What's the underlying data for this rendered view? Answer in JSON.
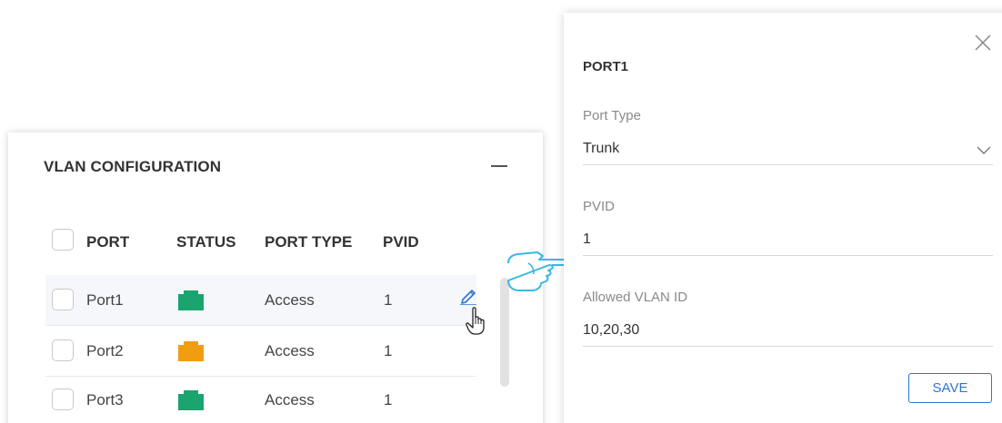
{
  "vlan_panel": {
    "title": "VLAN CONFIGURATION",
    "columns": {
      "port": "PORT",
      "status": "STATUS",
      "port_type": "PORT TYPE",
      "pvid": "PVID"
    },
    "rows": [
      {
        "port": "Port1",
        "status": "up",
        "status_color": "#1aa570",
        "port_type": "Access",
        "pvid": "1"
      },
      {
        "port": "Port2",
        "status": "warning",
        "status_color": "#f29d0f",
        "port_type": "Access",
        "pvid": "1"
      },
      {
        "port": "Port3",
        "status": "up",
        "status_color": "#1aa570",
        "port_type": "Access",
        "pvid": "1"
      }
    ],
    "icons": {
      "collapse": "minus-icon",
      "edit": "pencil-icon",
      "cursor": "hand-pointer-icon"
    }
  },
  "port_drawer": {
    "title": "PORT1",
    "port_type_label": "Port Type",
    "port_type_value": "Trunk",
    "pvid_label": "PVID",
    "pvid_value": "1",
    "allowed_vlan_label": "Allowed VLAN ID",
    "allowed_vlan_value": "10,20,30",
    "save_label": "SAVE",
    "icons": {
      "close": "close-icon",
      "dropdown": "chevron-down-icon"
    }
  },
  "colors": {
    "accent": "#2f76cf",
    "status_up": "#1aa570",
    "status_warning": "#f29d0f",
    "pointer_hand": "#3ab7e6"
  }
}
